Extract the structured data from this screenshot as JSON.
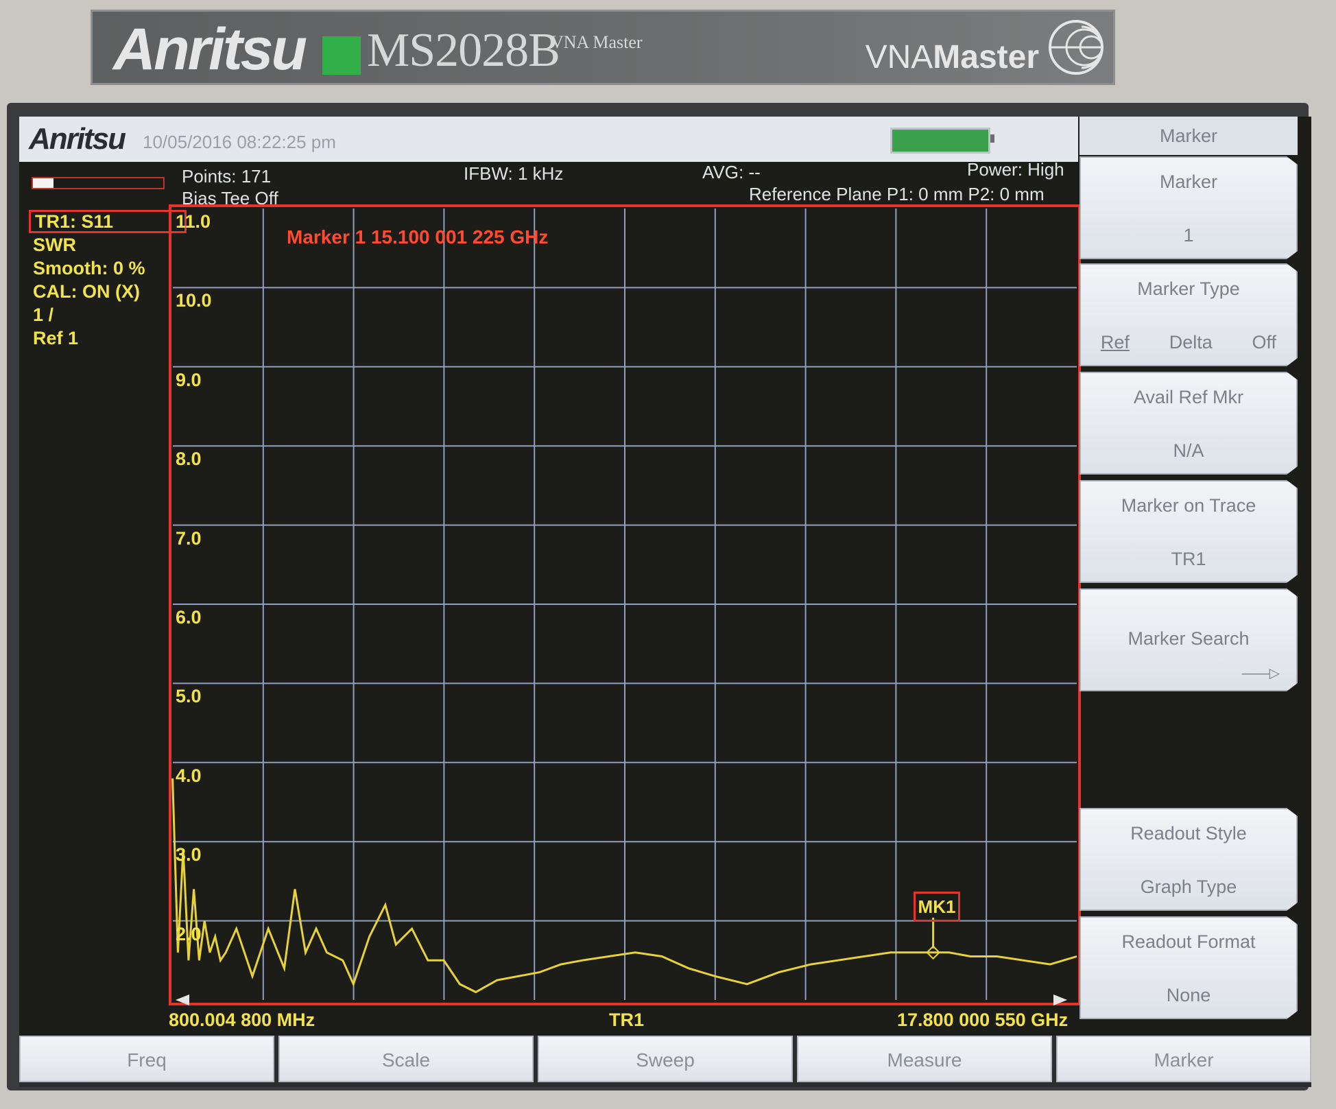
{
  "device": {
    "brand": "Anritsu",
    "model": "MS2028B",
    "model_sub": "VNA Master",
    "product_prefix": "VNA",
    "product_suffix": "Master"
  },
  "header": {
    "logo": "Anritsu",
    "datetime": "10/05/2016 08:22:25 pm",
    "battery_level": 0.8
  },
  "status": {
    "points": "Points: 171",
    "bias_tee": "Bias Tee Off",
    "ifbw": "IFBW: 1 kHz",
    "avg": "AVG: --",
    "power": "Power: High",
    "ref_plane": "Reference Plane P1: 0 mm P2: 0 mm",
    "sweep_progress": 0.16
  },
  "trace_info": {
    "trace": "TR1: S11",
    "format": "SWR",
    "smooth": "Smooth: 0 %",
    "cal": "CAL: ON (X)",
    "scale": "1 /",
    "ref": "Ref 1"
  },
  "graph": {
    "marker_readout": "Marker 1 15.100 001 225 GHz",
    "marker_label": "MK1",
    "start_freq": "800.004 800 MHz",
    "stop_freq": "17.800 000 550 GHz",
    "trace_label": "TR1",
    "y_labels": [
      "11.0",
      "10.0",
      "9.0",
      "8.0",
      "7.0",
      "6.0",
      "5.0",
      "4.0",
      "3.0",
      "2.0"
    ],
    "colors": {
      "grid": "#8f9fbf",
      "border": "#e5352a",
      "trace": "#e8d23a",
      "text": "#f3e34a"
    }
  },
  "chart_data": {
    "type": "line",
    "xlabel": "",
    "ylabel": "",
    "ylim": [
      1,
      11
    ],
    "x_range_ghz": [
      0.8048,
      17.8
    ],
    "grid": true,
    "series": [
      {
        "x": [
          0.8,
          0.9,
          1.0,
          1.1,
          1.2,
          1.3,
          1.4,
          1.5,
          1.6,
          1.7,
          1.8,
          2.0,
          2.3,
          2.6,
          2.9,
          3.1,
          3.3,
          3.5,
          3.7,
          4.0,
          4.2,
          4.5,
          4.8,
          5.0,
          5.3,
          5.6,
          5.9,
          6.2,
          6.5,
          6.9,
          7.3,
          7.7,
          8.1,
          8.5,
          9.0,
          9.5,
          10.0,
          10.5,
          11.0,
          11.6,
          12.2,
          12.8,
          13.3,
          13.8,
          14.3,
          14.8,
          15.1,
          15.4,
          15.8,
          16.3,
          16.8,
          17.3,
          17.8
        ],
        "values": [
          3.8,
          1.6,
          2.9,
          1.5,
          2.4,
          1.5,
          2.0,
          1.6,
          1.8,
          1.5,
          1.6,
          1.9,
          1.3,
          1.9,
          1.4,
          2.4,
          1.6,
          1.9,
          1.6,
          1.5,
          1.2,
          1.8,
          2.2,
          1.7,
          1.9,
          1.5,
          1.5,
          1.2,
          1.1,
          1.25,
          1.3,
          1.35,
          1.45,
          1.5,
          1.55,
          1.6,
          1.55,
          1.4,
          1.3,
          1.2,
          1.35,
          1.45,
          1.5,
          1.55,
          1.6,
          1.6,
          1.6,
          1.6,
          1.55,
          1.55,
          1.5,
          1.45,
          1.55
        ]
      }
    ],
    "markers": [
      {
        "label": "MK1",
        "x": 15.1,
        "y": 1.6
      }
    ]
  },
  "softkeys": {
    "title": "Marker",
    "marker": {
      "top": "Marker",
      "bottom": "1"
    },
    "marker_type": {
      "top": "Marker Type",
      "options": [
        "Ref",
        "Delta",
        "Off"
      ],
      "selected": "Ref"
    },
    "avail_ref": {
      "top": "Avail Ref Mkr",
      "bottom": "N/A"
    },
    "marker_on_trace": {
      "top": "Marker on Trace",
      "bottom": "TR1"
    },
    "marker_search": {
      "label": "Marker Search"
    },
    "readout_style": {
      "top": "Readout Style",
      "bottom": "Graph Type"
    },
    "readout_format": {
      "top": "Readout Format",
      "bottom": "None"
    }
  },
  "tabs": [
    "Freq",
    "Scale",
    "Sweep",
    "Measure",
    "Marker"
  ]
}
